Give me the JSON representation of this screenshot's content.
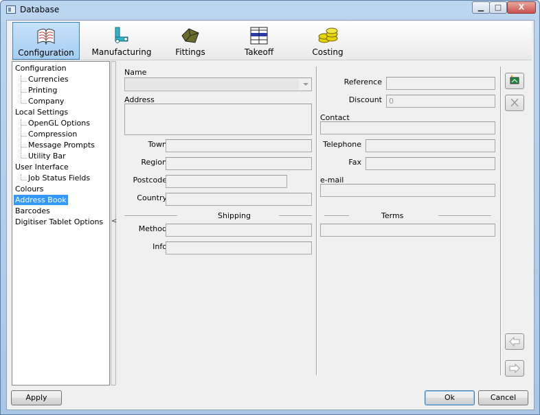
{
  "window": {
    "title": "Database",
    "minimize": "▁",
    "maximize": "□",
    "close": "X"
  },
  "toolbar": {
    "tabs": [
      {
        "label": "Configuration",
        "icon": "book-icon"
      },
      {
        "label": "Manufacturing",
        "icon": "machine-icon"
      },
      {
        "label": "Fittings",
        "icon": "fitting-icon"
      },
      {
        "label": "Takeoff",
        "icon": "takeoff-icon"
      },
      {
        "label": "Costing",
        "icon": "coins-icon"
      }
    ],
    "active": "Configuration"
  },
  "tree": {
    "items": [
      {
        "label": "Configuration",
        "level": 0
      },
      {
        "label": "Currencies",
        "level": 1
      },
      {
        "label": "Printing",
        "level": 1
      },
      {
        "label": "Company",
        "level": 1
      },
      {
        "label": "Local Settings",
        "level": 0
      },
      {
        "label": "OpenGL Options",
        "level": 1
      },
      {
        "label": "Compression",
        "level": 1
      },
      {
        "label": "Message Prompts",
        "level": 1
      },
      {
        "label": "Utility Bar",
        "level": 1
      },
      {
        "label": "User Interface",
        "level": 0
      },
      {
        "label": "Job Status Fields",
        "level": 1
      },
      {
        "label": "Colours",
        "level": 0
      },
      {
        "label": "Address Book",
        "level": 0,
        "selected": true
      },
      {
        "label": "Barcodes",
        "level": 0
      },
      {
        "label": "Digitiser Tablet Options",
        "level": 0
      }
    ],
    "collapse_glyph": "<"
  },
  "form": {
    "name_label": "Name",
    "name_value": "",
    "address_label": "Address",
    "town_label": "Town",
    "region_label": "Region",
    "postcode_label": "Postcode",
    "country_label": "Country",
    "shipping_label": "Shipping",
    "method_label": "Method",
    "info_label": "Info",
    "reference_label": "Reference",
    "discount_label": "Discount",
    "discount_value": "0",
    "contact_label": "Contact",
    "telephone_label": "Telephone",
    "fax_label": "Fax",
    "email_label": "e-mail",
    "terms_label": "Terms"
  },
  "buttons": {
    "apply": "Apply",
    "ok": "Ok",
    "cancel": "Cancel"
  }
}
